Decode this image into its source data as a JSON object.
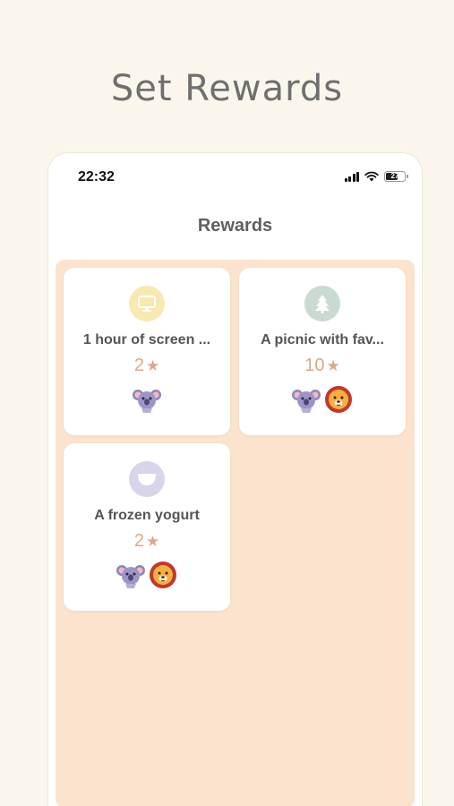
{
  "page": {
    "headline": "Set Rewards"
  },
  "status_bar": {
    "time": "22:32",
    "battery": "27"
  },
  "screen": {
    "title": "Rewards"
  },
  "rewards": [
    {
      "title": "1 hour of screen ...",
      "stars": "2",
      "icon": "tv-icon",
      "icon_bg": "#f8e9b0",
      "icon_color": "#ffffff",
      "avatars": [
        "koala-avatar"
      ]
    },
    {
      "title": "A picnic with fav...",
      "stars": "10",
      "icon": "tree-icon",
      "icon_bg": "#c9dbd0",
      "icon_color": "#ffffff",
      "avatars": [
        "koala-avatar",
        "lion-avatar"
      ]
    },
    {
      "title": "A frozen yogurt",
      "stars": "2",
      "icon": "yogurt-icon",
      "icon_bg": "#d8d4ea",
      "icon_color": "#ffffff",
      "avatars": [
        "koala-avatar",
        "lion-avatar"
      ]
    }
  ],
  "colors": {
    "background": "#faf6ec",
    "panel": "#fbe3cd",
    "star": "#dba98a"
  }
}
